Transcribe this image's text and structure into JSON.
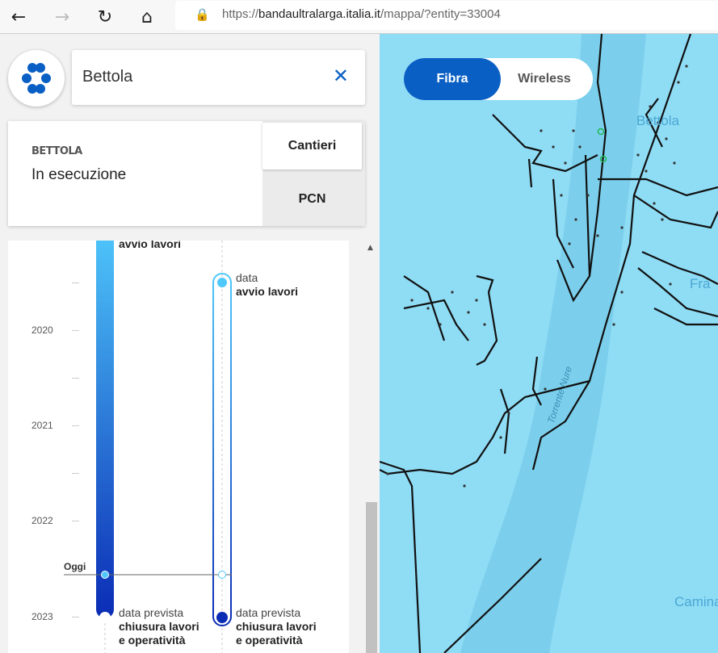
{
  "browser": {
    "url_prefix": "https://",
    "url_host": "bandaultralarga.italia.it",
    "url_path": "/mappa/?entity=33004"
  },
  "search": {
    "value": "Bettola"
  },
  "info": {
    "place": "BETTOLA",
    "status": "In esecuzione",
    "tabs": [
      {
        "label": "Cantieri",
        "active": true
      },
      {
        "label": "PCN",
        "active": false
      }
    ]
  },
  "timeline": {
    "years": [
      "2020",
      "2021",
      "2022",
      "2023"
    ],
    "today_label": "Oggi",
    "bar1": {
      "start_bold": "avvio lavori",
      "end_light": "data prevista",
      "end_bold1": "chiusura lavori",
      "end_bold2": "e operatività"
    },
    "bar2": {
      "start_light": "data",
      "start_bold": "avvio lavori",
      "end_light": "data prevista",
      "end_bold1": "chiusura lavori",
      "end_bold2": "e operatività"
    }
  },
  "map": {
    "toggle": {
      "fibra": "Fibra",
      "wireless": "Wireless",
      "active": "Fibra"
    },
    "labels": {
      "town": "Bettola",
      "river": "Torrente Nure",
      "frazione": "Fra",
      "caminata": "Camina"
    }
  },
  "colors": {
    "accent": "#0a5fc4",
    "map_bg": "#8fdcf5",
    "bar_top": "#4fc8fb",
    "bar_bottom": "#0a2cb5"
  }
}
